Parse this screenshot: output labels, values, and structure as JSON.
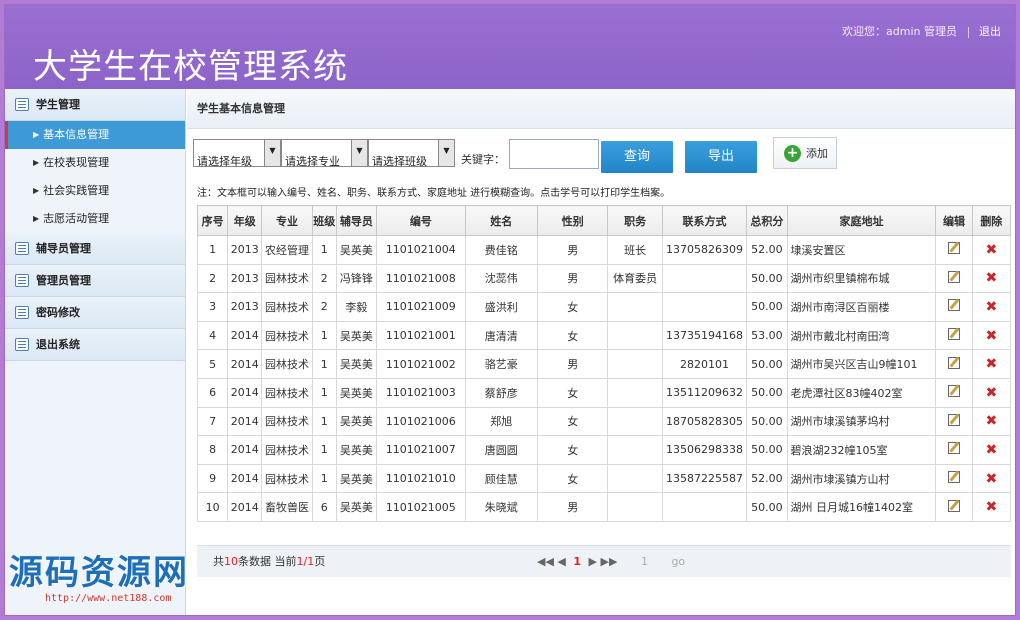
{
  "header": {
    "app_title": "大学生在校管理系统",
    "welcome": "欢迎您：admin 管理员",
    "logout": "退出"
  },
  "sidebar": {
    "groups": [
      {
        "label": "学生管理"
      },
      {
        "label": "辅导员管理"
      },
      {
        "label": "管理员管理"
      },
      {
        "label": "密码修改"
      },
      {
        "label": "退出系统"
      }
    ],
    "items": [
      {
        "label": "基本信息管理"
      },
      {
        "label": "在校表现管理"
      },
      {
        "label": "社会实践管理"
      },
      {
        "label": "志愿活动管理"
      }
    ]
  },
  "main": {
    "title": "学生基本信息管理",
    "filters": {
      "grade": "请选择年级",
      "major": "请选择专业",
      "class": "请选择班级",
      "keyword_label": "关键字："
    },
    "buttons": {
      "search": "查询",
      "export": "导出",
      "add": "添加"
    },
    "note": "注：文本框可以输入编号、姓名、职务、联系方式、家庭地址 进行模糊查询。点击学号可以打印学生档案。",
    "columns": [
      "序号",
      "年级",
      "专业",
      "班级",
      "辅导员",
      "编号",
      "姓名",
      "性别",
      "职务",
      "联系方式",
      "总积分",
      "家庭地址",
      "编辑",
      "删除"
    ],
    "rows": [
      [
        "1",
        "2013",
        "农经管理",
        "1",
        "吴英美",
        "1101021004",
        "费佳铭",
        "男",
        "班长",
        "13705826309",
        "52.00",
        "埭溪安置区"
      ],
      [
        "2",
        "2013",
        "园林技术",
        "2",
        "冯锋锋",
        "1101021008",
        "沈蕊伟",
        "男",
        "体育委员",
        "",
        "50.00",
        "湖州市织里镇棉布城"
      ],
      [
        "3",
        "2013",
        "园林技术",
        "2",
        "李毅",
        "1101021009",
        "盛洪利",
        "女",
        "",
        "",
        "50.00",
        "湖州市南浔区百丽楼"
      ],
      [
        "4",
        "2014",
        "园林技术",
        "1",
        "吴英美",
        "1101021001",
        "唐清清",
        "女",
        "",
        "13735194168",
        "53.00",
        "湖州市戴北村南田湾"
      ],
      [
        "5",
        "2014",
        "园林技术",
        "1",
        "吴英美",
        "1101021002",
        "骆艺豪",
        "男",
        "",
        "2820101",
        "50.00",
        "湖州市吴兴区吉山9幢101"
      ],
      [
        "6",
        "2014",
        "园林技术",
        "1",
        "吴英美",
        "1101021003",
        "蔡舒彦",
        "女",
        "",
        "13511209632",
        "50.00",
        "老虎潭社区83幢402室"
      ],
      [
        "7",
        "2014",
        "园林技术",
        "1",
        "吴英美",
        "1101021006",
        "郑旭",
        "女",
        "",
        "18705828305",
        "50.00",
        "湖州市埭溪镇茅坞村"
      ],
      [
        "8",
        "2014",
        "园林技术",
        "1",
        "吴英美",
        "1101021007",
        "唐圆圆",
        "女",
        "",
        "13506298338",
        "50.00",
        "碧浪湖232幢105室"
      ],
      [
        "9",
        "2014",
        "园林技术",
        "1",
        "吴英美",
        "1101021010",
        "顾佳慧",
        "女",
        "",
        "13587225587",
        "52.00",
        "湖州市埭溪镇方山村"
      ],
      [
        "10",
        "2014",
        "畜牧兽医",
        "6",
        "吴英美",
        "1101021005",
        "朱晓斌",
        "男",
        "",
        "",
        "50.00",
        "湖州 日月城16幢1402室"
      ]
    ],
    "pager": {
      "prefix": "共",
      "total": "10",
      "mid": "条数据 当前",
      "page": "1/1",
      "suffix": "页",
      "current": "1",
      "goto_value": "1",
      "go": "go"
    }
  },
  "watermark": {
    "text": "源码资源网",
    "url": "http://www.net188.com"
  }
}
